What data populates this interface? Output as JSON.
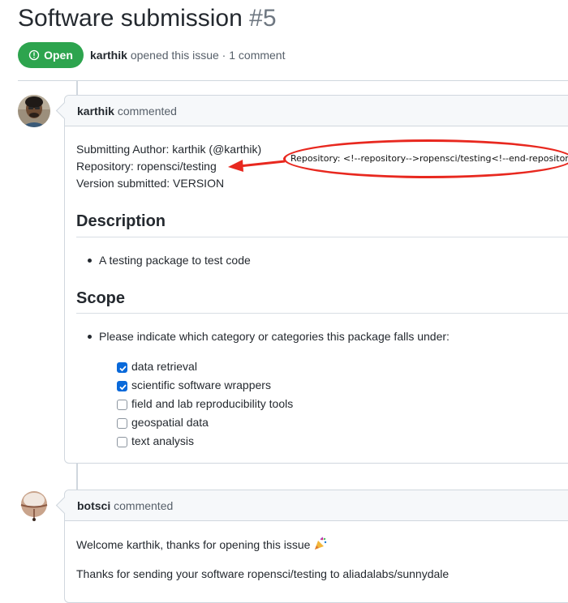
{
  "issue": {
    "title": "Software submission",
    "number": "#5",
    "state": "Open",
    "author": "karthik",
    "opened_text": "opened this issue",
    "separator": "·",
    "comment_count": "1 comment"
  },
  "comments": [
    {
      "author": "karthik",
      "action": "commented",
      "lines": [
        "Submitting Author: karthik (@karthik)",
        "Repository: ropensci/testing",
        "Version submitted: VERSION"
      ],
      "sections": [
        {
          "heading": "Description",
          "bullets": [
            "A testing package to test code"
          ]
        },
        {
          "heading": "Scope",
          "bullets": [
            "Please indicate which category or categories this package falls under:"
          ]
        }
      ],
      "checklist": [
        {
          "label": "data retrieval",
          "checked": true
        },
        {
          "label": "scientific software wrappers",
          "checked": true
        },
        {
          "label": "field and lab reproducibility tools",
          "checked": false
        },
        {
          "label": "geospatial data",
          "checked": false
        },
        {
          "label": "text analysis",
          "checked": false
        }
      ]
    },
    {
      "author": "botsci",
      "action": "commented",
      "lines": [
        "Welcome karthik, thanks for opening this issue",
        "Thanks for sending your software ropensci/testing to aliadalabs/sunnydale"
      ]
    }
  ],
  "annotation": {
    "callout_text": "Repository: <!--repository-->ropensci/testing<!--end-repository-->",
    "color": "#e8281f"
  },
  "colors": {
    "open_badge": "#2da44e",
    "checkbox_checked": "#0969da",
    "border": "#d0d7de",
    "header_bg": "#f6f8fa"
  }
}
